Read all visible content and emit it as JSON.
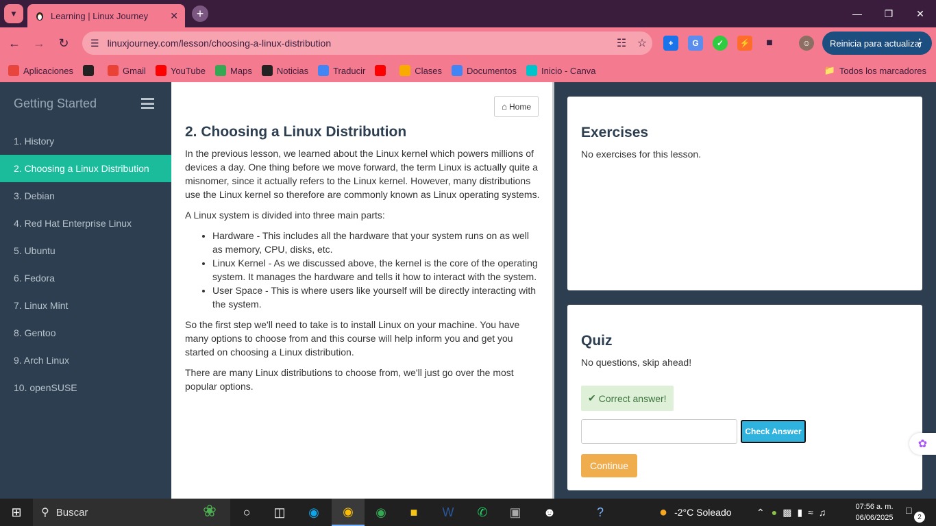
{
  "browser": {
    "tab_title": "Learning | Linux Journey",
    "url": "linuxjourney.com/lesson/choosing-a-linux-distribution",
    "update_label": "Reinicia para actualizar",
    "bookmarks": [
      {
        "label": "Aplicaciones",
        "icon": "apps-grid-icon",
        "color": "#e8453c"
      },
      {
        "label": "",
        "icon": "globe-icon",
        "color": "#222222"
      },
      {
        "label": "Gmail",
        "icon": "gmail-icon",
        "color": "#ea4335"
      },
      {
        "label": "YouTube",
        "icon": "youtube-icon",
        "color": "#ff0000"
      },
      {
        "label": "Maps",
        "icon": "maps-icon",
        "color": "#34a853"
      },
      {
        "label": "Noticias",
        "icon": "news-icon",
        "color": "#222222"
      },
      {
        "label": "Traducir",
        "icon": "translate-icon",
        "color": "#4285f4"
      },
      {
        "label": "",
        "icon": "youtube-icon",
        "color": "#ff0000"
      },
      {
        "label": "Clases",
        "icon": "classroom-icon",
        "color": "#f9ab00"
      },
      {
        "label": "Documentos",
        "icon": "docs-icon",
        "color": "#4285f4"
      },
      {
        "label": "Inicio - Canva",
        "icon": "canva-icon",
        "color": "#00c4cc"
      }
    ],
    "all_bookmarks": "Todos los marcadores"
  },
  "sidebar": {
    "title": "Getting Started",
    "items": [
      {
        "label": "1. History",
        "active": false
      },
      {
        "label": "2. Choosing a Linux Distribution",
        "active": true
      },
      {
        "label": "3. Debian",
        "active": false
      },
      {
        "label": "4. Red Hat Enterprise Linux",
        "active": false
      },
      {
        "label": "5. Ubuntu",
        "active": false
      },
      {
        "label": "6. Fedora",
        "active": false
      },
      {
        "label": "7. Linux Mint",
        "active": false
      },
      {
        "label": "8. Gentoo",
        "active": false
      },
      {
        "label": "9. Arch Linux",
        "active": false
      },
      {
        "label": "10. openSUSE",
        "active": false
      }
    ]
  },
  "lesson": {
    "home_label": "Home",
    "title": "2. Choosing a Linux Distribution",
    "p1": "In the previous lesson, we learned about the Linux kernel which powers millions of devices a day. One thing before we move forward, the term Linux is actually quite a misnomer, since it actually refers to the Linux kernel. However, many distributions use the Linux kernel so therefore are commonly known as Linux operating systems.",
    "p2": "A Linux system is divided into three main parts:",
    "bullets": [
      "Hardware - This includes all the hardware that your system runs on as well as memory, CPU, disks, etc.",
      "Linux Kernel - As we discussed above, the kernel is the core of the operating system. It manages the hardware and tells it how to interact with the system.",
      "User Space - This is where users like yourself will be directly interacting with the system."
    ],
    "p3": "So the first step we'll need to take is to install Linux on your machine. You have many options to choose from and this course will help inform you and get you started on choosing a Linux distribution.",
    "p4": "There are many Linux distributions to choose from, we'll just go over the most popular options."
  },
  "exercises": {
    "title": "Exercises",
    "text": "No exercises for this lesson."
  },
  "quiz": {
    "title": "Quiz",
    "text": "No questions, skip ahead!",
    "correct": "Correct answer!",
    "answer_value": "",
    "check_label": "Check Answer",
    "continue_label": "Continue"
  },
  "taskbar": {
    "search_placeholder": "Buscar",
    "weather": "-2°C  Soleado",
    "time": "07:56 a. m.",
    "date": "06/06/2025",
    "notifications": "2"
  }
}
